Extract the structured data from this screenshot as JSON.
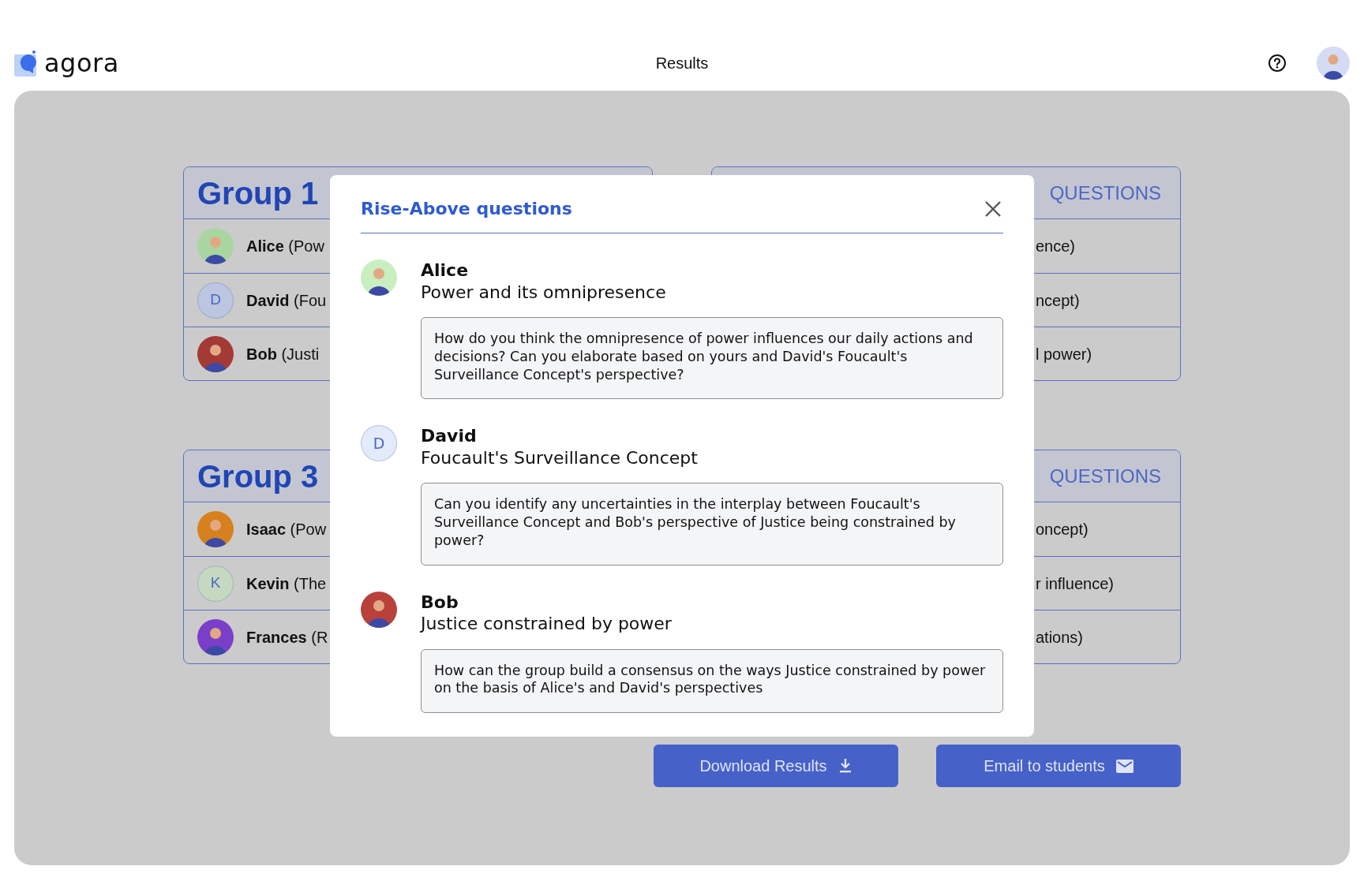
{
  "header": {
    "brand": "agora",
    "title": "Results",
    "user_avatar": {
      "kind": "photo",
      "color": "#d4dcf5"
    }
  },
  "groups": [
    {
      "title": "Group 1",
      "members": [
        {
          "name": "Alice",
          "topic": "(Pow",
          "avatar": {
            "kind": "photo",
            "color": "#a9d6a0"
          }
        },
        {
          "name": "David",
          "topic": "(Fou",
          "avatar": {
            "kind": "initial",
            "initial": "D",
            "color": "#bcc6e0"
          }
        },
        {
          "name": "Bob",
          "topic": "(Justi",
          "avatar": {
            "kind": "photo",
            "color": "#a33a36"
          }
        }
      ]
    },
    {
      "title": "QUESTIONS",
      "rows": [
        "ence)",
        "ncept)",
        "l power)"
      ]
    },
    {
      "title": "Group 3",
      "members": [
        {
          "name": "Isaac",
          "topic": "(Pow",
          "avatar": {
            "kind": "photo",
            "color": "#d7801e"
          }
        },
        {
          "name": "Kevin",
          "topic": "(The",
          "avatar": {
            "kind": "initial",
            "initial": "K",
            "color": "#c4d9c0"
          }
        },
        {
          "name": "Frances",
          "topic": "(R",
          "avatar": {
            "kind": "photo",
            "color": "#7a3fc9"
          }
        }
      ]
    },
    {
      "title": "QUESTIONS",
      "rows": [
        "oncept)",
        "r influence)",
        "ations)"
      ]
    }
  ],
  "buttons": [
    {
      "label": "Download Results",
      "kind": "download"
    },
    {
      "label": "Email to students",
      "kind": "mail"
    }
  ],
  "modal": {
    "title": "Rise-Above questions",
    "entries": [
      {
        "name": "Alice",
        "topic": "Power and its omnipresence",
        "avatar": {
          "kind": "photo",
          "color": "#c9efc0"
        },
        "question": "How do you think the omnipresence of power influences our daily actions and decisions? Can you elaborate based on yours and David's Foucault's Surveillance Concept's perspective?"
      },
      {
        "name": "David",
        "topic": "Foucault's Surveillance Concept",
        "avatar": {
          "kind": "initial",
          "initial": "D",
          "color": "#e3ebfb"
        },
        "question": "Can you identify any uncertainties in the interplay between Foucault's Surveillance Concept and Bob's perspective of Justice being constrained by power?"
      },
      {
        "name": "Bob",
        "topic": "Justice constrained by power",
        "avatar": {
          "kind": "photo",
          "color": "#b8413c"
        },
        "question": "How can the group build a consensus on the ways Justice constrained by power on the basis of Alice's and David's perspectives"
      }
    ]
  }
}
